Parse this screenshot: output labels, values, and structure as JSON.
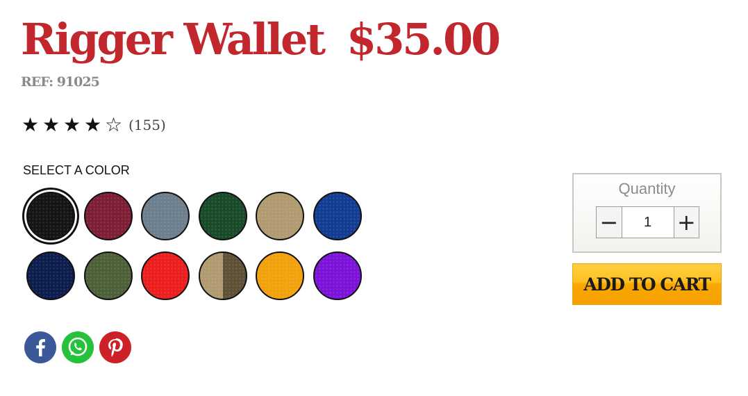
{
  "product": {
    "title": "Rigger Wallet",
    "price": "$35.00",
    "ref": "REF: 91025"
  },
  "rating": {
    "stars_filled": 4,
    "stars_total": 5,
    "count_text": "(155)",
    "star_filled_glyph": "★",
    "star_empty_glyph": "☆"
  },
  "color_picker": {
    "label": "SELECT A COLOR",
    "selected_index": 0,
    "swatches": [
      {
        "name": "black",
        "color": "#141414"
      },
      {
        "name": "burgundy",
        "color": "#7d1e35"
      },
      {
        "name": "grey",
        "color": "#6d7e8d"
      },
      {
        "name": "dark-green",
        "color": "#174a28"
      },
      {
        "name": "tan",
        "color": "#b09a70"
      },
      {
        "name": "royal-blue",
        "color": "#123c92"
      },
      {
        "name": "navy",
        "color": "#0c1d4d"
      },
      {
        "name": "olive",
        "color": "#4c6038"
      },
      {
        "name": "red",
        "color": "#ec1d1d"
      },
      {
        "name": "tan-brown",
        "color": "#b09a70",
        "color2": "#5e5037"
      },
      {
        "name": "gold",
        "color": "#f2a10b"
      },
      {
        "name": "purple",
        "color": "#7c12d8"
      }
    ]
  },
  "social": [
    {
      "name": "facebook-icon",
      "color": "#3b5998"
    },
    {
      "name": "whatsapp-icon",
      "color": "#25c13a"
    },
    {
      "name": "pinterest-icon",
      "color": "#cc2127"
    }
  ],
  "quantity": {
    "label": "Quantity",
    "value": "1",
    "minus_glyph": "−",
    "plus_glyph": "+"
  },
  "cart": {
    "add_label": "ADD TO CART"
  }
}
